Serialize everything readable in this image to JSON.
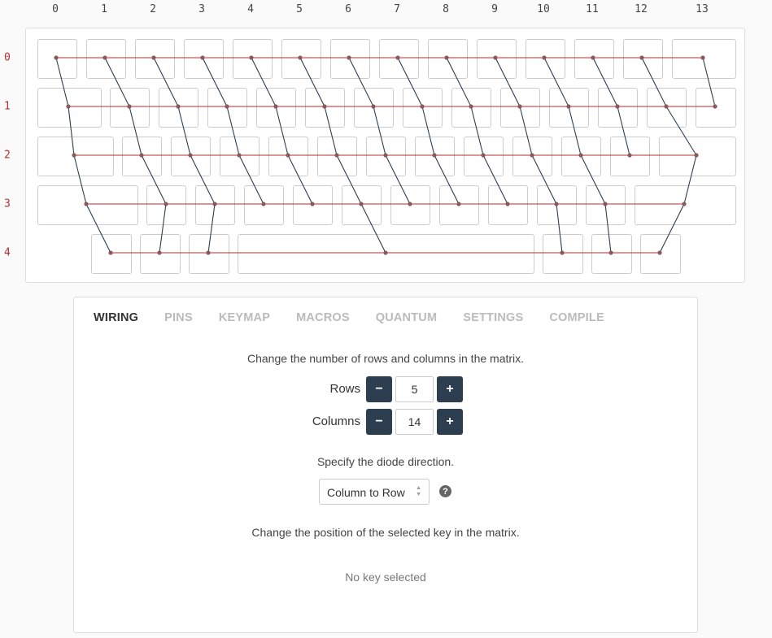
{
  "matrix": {
    "column_numbers": [
      "0",
      "1",
      "2",
      "3",
      "4",
      "5",
      "6",
      "7",
      "8",
      "9",
      "10",
      "11",
      "12",
      "13"
    ],
    "row_numbers": [
      "0",
      "1",
      "2",
      "3",
      "4"
    ],
    "wire_color_row": "#b03030",
    "wire_color_col": "#2c3e50"
  },
  "tabs": [
    "WIRING",
    "PINS",
    "KEYMAP",
    "MACROS",
    "QUANTUM",
    "SETTINGS",
    "COMPILE"
  ],
  "active_tab": "WIRING",
  "wiring": {
    "matrix_intro": "Change the number of rows and columns in the matrix.",
    "rows_label": "Rows",
    "rows_value": "5",
    "columns_label": "Columns",
    "columns_value": "14",
    "minus_symbol": "−",
    "plus_symbol": "+",
    "diode_intro": "Specify the diode direction.",
    "diode_direction": "Column to Row",
    "help_symbol": "?",
    "position_intro": "Change the position of the selected key in the matrix.",
    "no_key_text": "No key selected"
  }
}
